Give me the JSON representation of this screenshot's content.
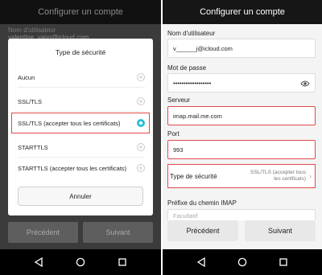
{
  "left": {
    "title": "Configurer un compte",
    "bg_label": "Nom d'utilisateur",
    "bg_input": "valentine_yano@icloud.com",
    "dialog": {
      "title": "Type de sécurité",
      "options": [
        {
          "label": "Aucun",
          "selected": false
        },
        {
          "label": "SSL/TLS",
          "selected": false
        },
        {
          "label": "SSL/TLS (accepter tous les certificats)",
          "selected": true
        },
        {
          "label": "STARTTLS",
          "selected": false
        },
        {
          "label": "STARTTLS (accepter tous les certificats)",
          "selected": false
        }
      ],
      "cancel": "Annuler"
    },
    "buttons": {
      "prev": "Précédent",
      "next": "Suivant"
    }
  },
  "right": {
    "title": "Configurer un compte",
    "username_label": "Nom d'utilisateur",
    "username_value": "v______j@icloud.com",
    "password_label": "Mot de passe",
    "password_value": "••••••••••••••••••",
    "server_label": "Serveur",
    "server_value": "imap.mail.me.com",
    "port_label": "Port",
    "port_value": "993",
    "security_label": "Type de sécurité",
    "security_value": "SSL/TLS (accepter tous les certificats)",
    "prefix_label": "Préfixe du chemin IMAP",
    "prefix_placeholder": "Facultatif",
    "buttons": {
      "prev": "Précédent",
      "next": "Suivant"
    }
  },
  "colors": {
    "accent": "#2bc0d4",
    "highlight": "#e04a4a",
    "titlebar": "#161616"
  },
  "icons": [
    "back-icon",
    "home-icon",
    "recents-icon",
    "eye-icon",
    "chevron-right-icon"
  ]
}
